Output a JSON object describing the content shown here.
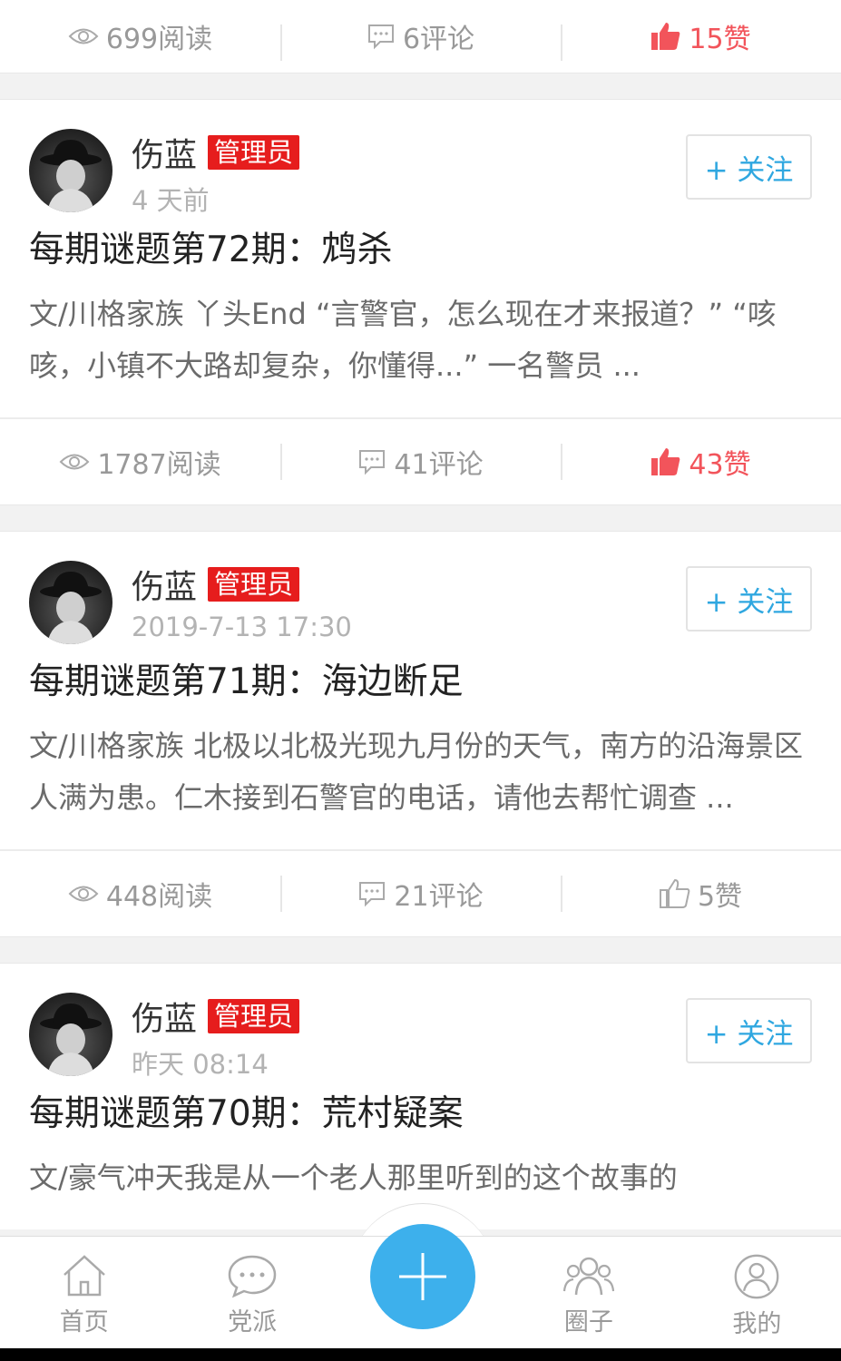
{
  "top_stats": {
    "views": "699阅读",
    "comments": "6评论",
    "likes": "15赞",
    "liked": true
  },
  "posts": [
    {
      "author": "伤蓝",
      "badge": "管理员",
      "time": "4 天前",
      "follow_label": "+ 关注",
      "title": "每期谜题第72期：鸩杀",
      "excerpt": "文/川格家族 丫头End “言警官，怎么现在才来报道？” “咳咳，小镇不大路却复杂，你懂得...” 一名警员 ...",
      "views": "1787阅读",
      "comments": "41评论",
      "likes": "43赞",
      "liked": true
    },
    {
      "author": "伤蓝",
      "badge": "管理员",
      "time": "2019-7-13 17:30",
      "follow_label": "+ 关注",
      "title": "每期谜题第71期：海边断足",
      "excerpt": "文/川格家族 北极以北极光现九月份的天气，南方的沿海景区人满为患。仁木接到石警官的电话，请他去帮忙调查 ...",
      "views": "448阅读",
      "comments": "21评论",
      "likes": "5赞",
      "liked": false
    },
    {
      "author": "伤蓝",
      "badge": "管理员",
      "time": "昨天 08:14",
      "follow_label": "+ 关注",
      "title": "每期谜题第70期：荒村疑案",
      "excerpt": "文/豪气冲天我是从一个老人那里听到的这个故事的"
    }
  ],
  "nav": [
    {
      "label": "首页",
      "icon": "home-icon"
    },
    {
      "label": "党派",
      "icon": "chat-bubble-icon"
    },
    {
      "label": "圈子",
      "icon": "group-icon"
    },
    {
      "label": "我的",
      "icon": "user-icon"
    }
  ],
  "colors": {
    "accent": "#3db0ec",
    "like": "#f2545b",
    "badge": "#e61d1d",
    "follow": "#2fa7e0"
  }
}
